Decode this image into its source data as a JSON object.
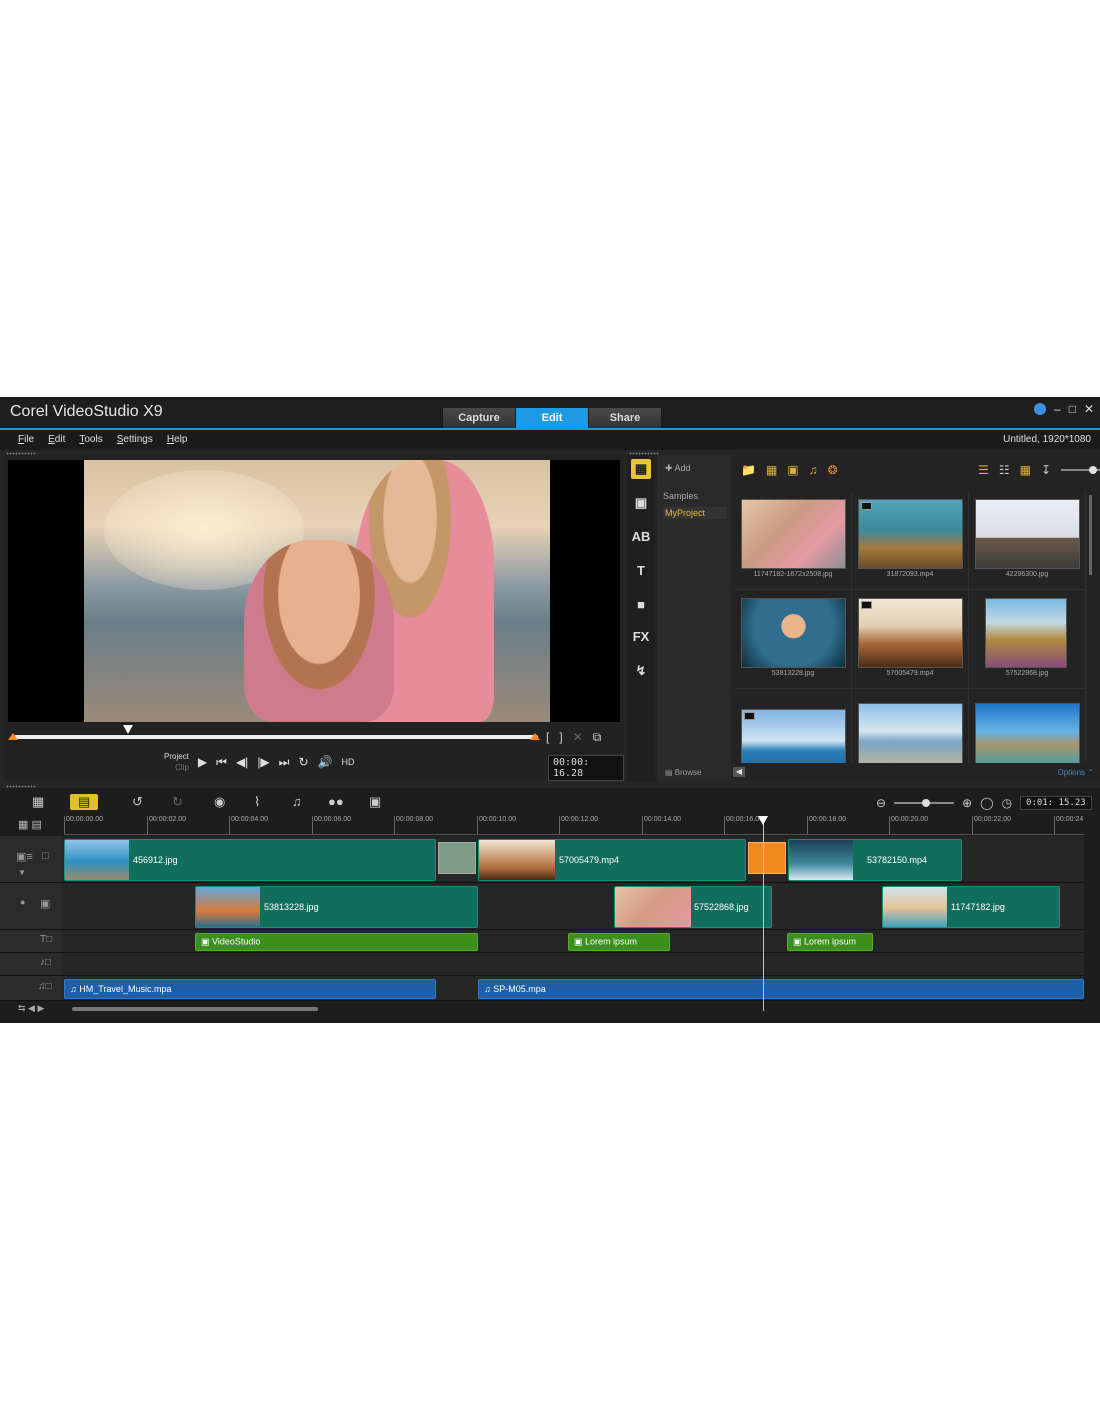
{
  "app": {
    "brand": "Corel VideoStudio X9",
    "tabs": [
      "Capture",
      "Edit",
      "Share"
    ],
    "active_tab": "Edit"
  },
  "menu": [
    "File",
    "Edit",
    "Tools",
    "Settings",
    "Help"
  ],
  "project_info": "Untitled, 1920*1080",
  "preview": {
    "mode_project": "Project",
    "mode_clip": "Clip",
    "hd": "HD",
    "timecode": "00:00: 16.28"
  },
  "library": {
    "add": "Add",
    "folders": [
      "Samples",
      "MyProject"
    ],
    "selected_folder": "MyProject",
    "browse": "Browse",
    "options": "Options",
    "items": [
      {
        "name": "11747182-1672x2508.jpg",
        "video": false
      },
      {
        "name": "31872093.mp4",
        "video": true
      },
      {
        "name": "42296300.jpg",
        "video": false
      },
      {
        "name": "53813228.jpg",
        "video": false
      },
      {
        "name": "57005479.mp4",
        "video": true
      },
      {
        "name": "57522868.jpg",
        "video": false
      },
      {
        "name": "",
        "video": true
      },
      {
        "name": "",
        "video": false
      },
      {
        "name": "",
        "video": false
      }
    ]
  },
  "timeline": {
    "timecode": "0:01: 15.23",
    "ruler": [
      "00:00:00.00",
      "00:00:02.00",
      "00:00:04.00",
      "00:00:06.00",
      "00:00:08.00",
      "00:00:10.00",
      "00:00:12.00",
      "00:00:14.00",
      "00:00:16.00",
      "00:00:18.00",
      "00:00:20.00",
      "00:00:22.00",
      "00:00:24"
    ],
    "video_clips": [
      "456912.jpg",
      "57005479.mp4",
      "53782150.mp4"
    ],
    "overlay_clips": [
      "53813228.jpg",
      "57522868.jpg",
      "11747182.jpg"
    ],
    "title_clips": [
      "VideoStudio",
      "Lorem ipsum",
      "Lorem ipsum"
    ],
    "audio_clips": [
      "HM_Travel_Music.mpa",
      "SP-M05.mpa"
    ]
  }
}
